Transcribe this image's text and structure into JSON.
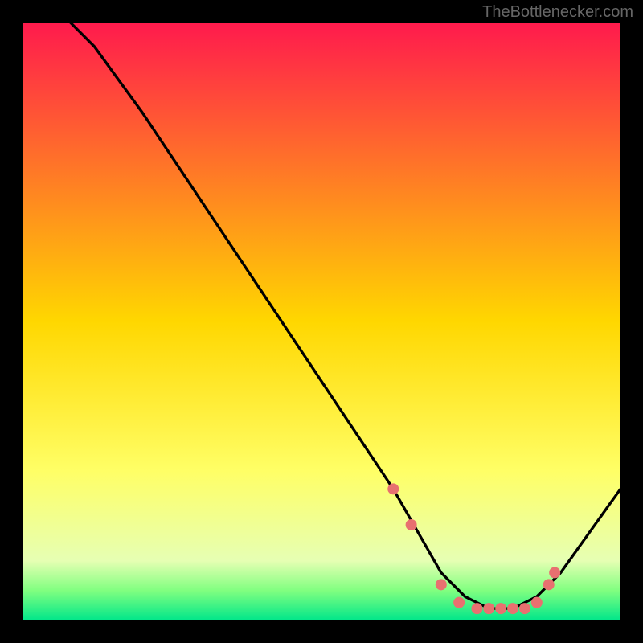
{
  "watermark": "TheBottlenecker.com",
  "chart_data": {
    "type": "line",
    "title": "",
    "xlabel": "",
    "ylabel": "",
    "xlim": [
      0,
      100
    ],
    "ylim": [
      0,
      100
    ],
    "background_gradient_stops": [
      {
        "offset": 0,
        "color": "#ff1a4d"
      },
      {
        "offset": 50,
        "color": "#ffd700"
      },
      {
        "offset": 75,
        "color": "#ffff66"
      },
      {
        "offset": 90,
        "color": "#e6ffb3"
      },
      {
        "offset": 95,
        "color": "#80ff80"
      },
      {
        "offset": 100,
        "color": "#00e68a"
      }
    ],
    "series": [
      {
        "name": "bottleneck-curve",
        "color": "#000000",
        "x": [
          8,
          12,
          20,
          30,
          40,
          50,
          58,
          62,
          66,
          70,
          74,
          78,
          82,
          86,
          90,
          100
        ],
        "y": [
          100,
          96,
          85,
          70,
          55,
          40,
          28,
          22,
          15,
          8,
          4,
          2,
          2,
          4,
          8,
          22
        ]
      }
    ],
    "markers": {
      "name": "highlighted-points",
      "color": "#e87070",
      "radius": 7,
      "points": [
        {
          "x": 62,
          "y": 22
        },
        {
          "x": 65,
          "y": 16
        },
        {
          "x": 70,
          "y": 6
        },
        {
          "x": 73,
          "y": 3
        },
        {
          "x": 76,
          "y": 2
        },
        {
          "x": 78,
          "y": 2
        },
        {
          "x": 80,
          "y": 2
        },
        {
          "x": 82,
          "y": 2
        },
        {
          "x": 84,
          "y": 2
        },
        {
          "x": 86,
          "y": 3
        },
        {
          "x": 88,
          "y": 6
        },
        {
          "x": 89,
          "y": 8
        }
      ]
    }
  }
}
